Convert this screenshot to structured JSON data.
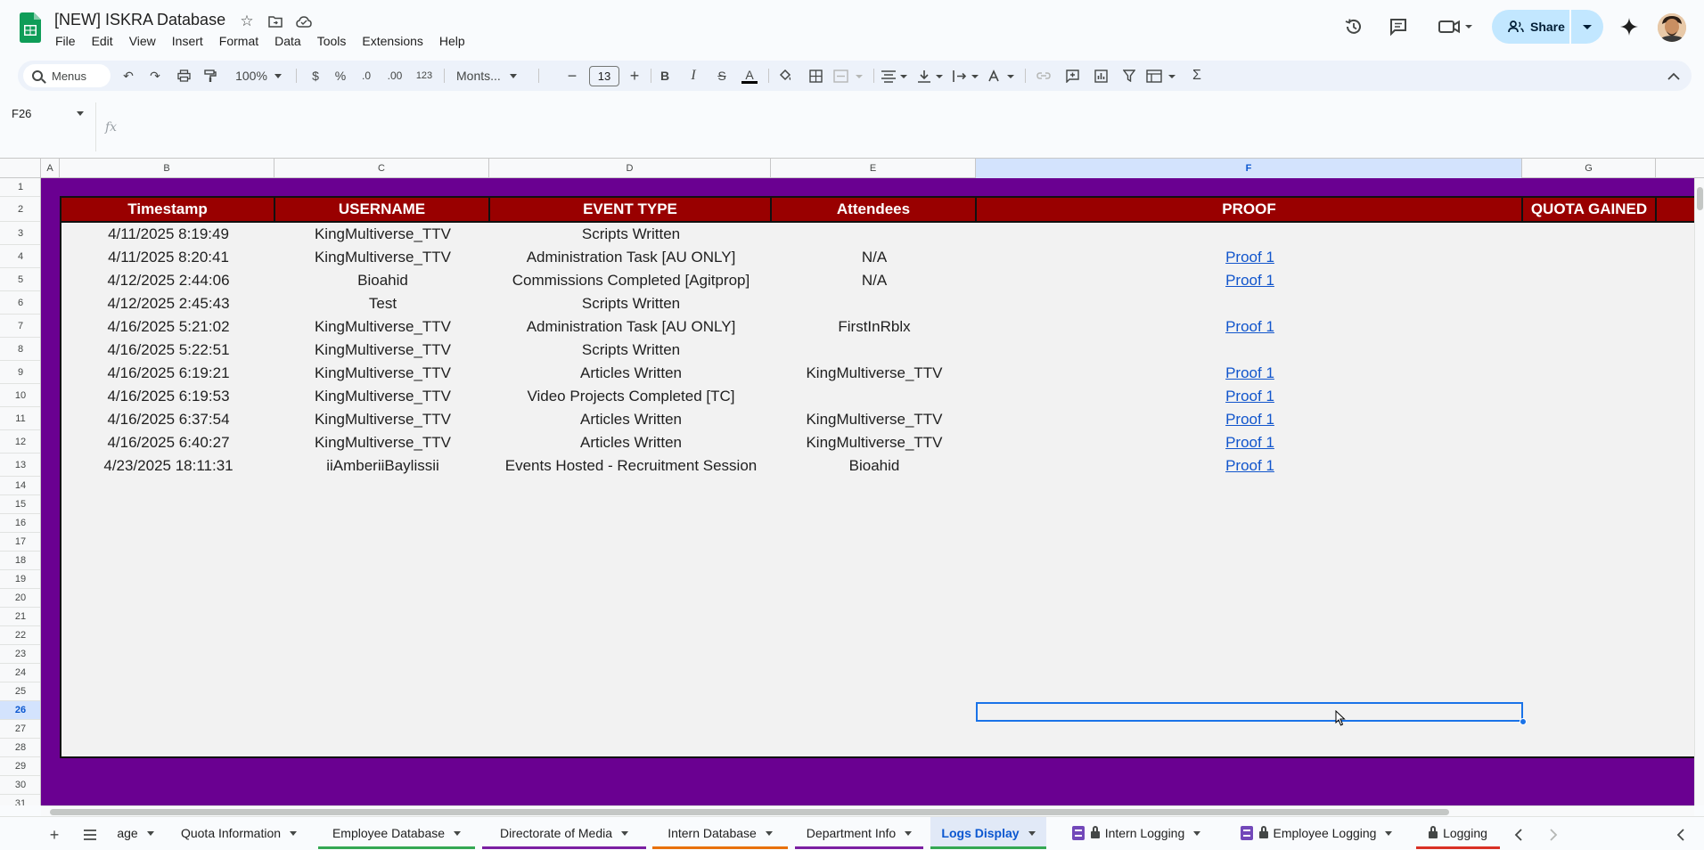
{
  "app": {
    "doc_title": "[NEW] ISKRA Database",
    "menus": [
      "File",
      "Edit",
      "View",
      "Insert",
      "Format",
      "Data",
      "Tools",
      "Extensions",
      "Help"
    ],
    "share_label": "Share"
  },
  "toolbar": {
    "menus_label": "Menus",
    "zoom": "100%",
    "currency": "$",
    "percent": "%",
    "dec_decrease": ".0",
    "dec_increase": ".00",
    "number_format": "123",
    "font": "Monts...",
    "font_size": "13",
    "bold": "B",
    "italic": "I",
    "strike": "S",
    "text_color": "A",
    "sum": "Σ"
  },
  "formula_bar": {
    "cell_ref": "F26",
    "fx": "fx",
    "value": ""
  },
  "columns": [
    "A",
    "B",
    "C",
    "D",
    "E",
    "F",
    "G"
  ],
  "selected_column": "F",
  "rows": [
    "1",
    "2",
    "3",
    "4",
    "5",
    "6",
    "7",
    "8",
    "9",
    "10",
    "11",
    "12",
    "13",
    "14",
    "15",
    "16",
    "17",
    "18",
    "19",
    "20",
    "21",
    "22",
    "23",
    "24",
    "25",
    "26",
    "27",
    "28",
    "29",
    "30",
    "31"
  ],
  "selected_row": "26",
  "table": {
    "headers": [
      "Timestamp",
      "USERNAME",
      "EVENT TYPE",
      "Attendees",
      "PROOF",
      "QUOTA GAINED"
    ],
    "rows": [
      [
        "4/11/2025 8:19:49",
        "KingMultiverse_TTV",
        "Scripts Written",
        "",
        "",
        ""
      ],
      [
        "4/11/2025 8:20:41",
        "KingMultiverse_TTV",
        "Administration Task [AU ONLY]",
        "N/A",
        "Proof 1",
        ""
      ],
      [
        "4/12/2025 2:44:06",
        "Bioahid",
        "Commissions Completed [Agitprop]",
        "N/A",
        "Proof 1",
        ""
      ],
      [
        "4/12/2025 2:45:43",
        "Test",
        "Scripts Written",
        "",
        "",
        ""
      ],
      [
        "4/16/2025 5:21:02",
        "KingMultiverse_TTV",
        "Administration Task [AU ONLY]",
        "FirstInRblx",
        "Proof 1",
        ""
      ],
      [
        "4/16/2025 5:22:51",
        "KingMultiverse_TTV",
        "Scripts Written",
        "",
        "",
        ""
      ],
      [
        "4/16/2025 6:19:21",
        "KingMultiverse_TTV",
        "Articles Written",
        "KingMultiverse_TTV",
        "Proof 1",
        ""
      ],
      [
        "4/16/2025 6:19:53",
        "KingMultiverse_TTV",
        "Video Projects Completed [TC]",
        "",
        "Proof 1",
        ""
      ],
      [
        "4/16/2025 6:37:54",
        "KingMultiverse_TTV",
        "Articles Written",
        "KingMultiverse_TTV",
        "Proof 1",
        ""
      ],
      [
        "4/16/2025 6:40:27",
        "KingMultiverse_TTV",
        "Articles Written",
        "KingMultiverse_TTV",
        "Proof 1",
        ""
      ],
      [
        "4/23/2025 18:11:31",
        "iiAmberiiBaylissii",
        "Events Hosted - Recruitment Session",
        "Bioahid",
        "Proof 1",
        ""
      ]
    ]
  },
  "tabs": [
    {
      "label": "age",
      "underline": ""
    },
    {
      "label": "Quota Information",
      "underline": ""
    },
    {
      "label": "Employee Database",
      "underline": "#34a853"
    },
    {
      "label": "Directorate of Media",
      "underline": "#7b1fa2"
    },
    {
      "label": "Intern Database",
      "underline": "#e8710a"
    },
    {
      "label": "Department Info",
      "underline": "#7b1fa2"
    },
    {
      "label": "Logs Display",
      "underline": "#34a853"
    },
    {
      "label": "Intern Logging",
      "underline": ""
    },
    {
      "label": "Employee Logging",
      "underline": ""
    },
    {
      "label": "Logging",
      "underline": "#d93025"
    }
  ],
  "active_tab": "Logs Display",
  "colors": {
    "sheet_bg": "#6a0091",
    "header_bg": "#990000",
    "link": "#1155cc",
    "selection": "#1a73e8"
  }
}
